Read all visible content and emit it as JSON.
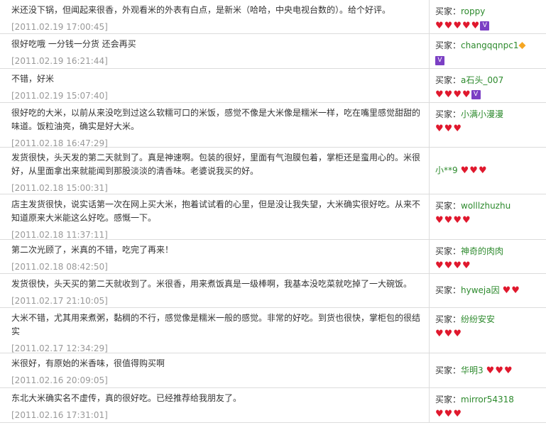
{
  "reviews": [
    {
      "comment": "米还没下锅，但闻起来很香，外观看米的外表有白点，是新米（哈哈，中央电视台数的）。给个好评。",
      "date": "[2011.02.19 17:00:45]",
      "buyer_label": "买家：",
      "buyer": "roppy",
      "hearts": 5,
      "badge": "vip",
      "height": 48
    },
    {
      "comment": "很好吃哦  一分钱一分货  还会再买",
      "date": "[2011.02.19 16:21:44]",
      "buyer_label": "买家：",
      "buyer": "changqqnpc1",
      "hearts": 0,
      "badge": "diamond+vip",
      "height": 49
    },
    {
      "comment": "不错，好米",
      "date": "[2011.02.19 15:07:40]",
      "buyer_label": "买家：",
      "buyer": "a石头_007",
      "hearts": 4,
      "badge": "vip",
      "height": 48
    },
    {
      "comment": "很好吃的大米，以前从来没吃到过这么软糯可口的米饭，感觉不像是大米像是糯米一样，吃在嘴里感觉甜甜的味道。饭粒油亮，确实是好大米。",
      "date": "[2011.02.18 16:47:29]",
      "buyer_label": "买家：",
      "buyer": "小满小漫漫",
      "hearts": 3,
      "badge": "",
      "height": 63
    },
    {
      "comment": "发货很快，头天发的第二天就到了。真是神速啊。包装的很好，里面有气泡膜包着，掌柜还是蛮用心的。米很好，从里面拿出来就能闻到那股淡淡的清香味。老婆说我买的好。",
      "date": "[2011.02.18 15:00:31]",
      "buyer_label": "",
      "buyer": "小**9",
      "hearts": 3,
      "badge": "",
      "inline": true,
      "height": 66
    },
    {
      "comment": "店主发货很快，说实话第一次在网上买大米，抱着试试看的心里，但是没让我失望，大米确实很好吃。从来不知道原来大米能这么好吃。感慨一下。",
      "date": "[2011.02.18 11:37:11]",
      "buyer_label": "买家：",
      "buyer": "wolllzhuzhu",
      "hearts": 4,
      "badge": "",
      "height": 64
    },
    {
      "comment": "第二次光顾了，米真的不错，吃完了再来！",
      "date": "[2011.02.18 08:42:50]",
      "buyer_label": "买家：",
      "buyer": "神奇的肉肉",
      "hearts": 4,
      "badge": "",
      "height": 48
    },
    {
      "comment": "发货很快，头天买的第二天就收到了。米很香，用来煮饭真是一级棒啊，我基本没吃菜就吃掉了一大碗饭。",
      "date": "[2011.02.17 21:10:05]",
      "buyer_label": "买家：",
      "buyer": "hyweja因",
      "hearts": 2,
      "badge": "",
      "inline": true,
      "height": 48
    },
    {
      "comment": "大米不错，尤其用来煮粥，黏稠的不行，感觉像是糯米一般的感觉。非常的好吃。到货也很快，掌柜包的很结实",
      "date": "[2011.02.17 12:34:29]",
      "buyer_label": "买家：",
      "buyer": "纷纷安安",
      "hearts": 3,
      "badge": "",
      "height": 64
    },
    {
      "comment": "米很好，有原始的米香味，很值得购买啊",
      "date": "[2011.02.16 20:09:05]",
      "buyer_label": "买家：",
      "buyer": "华明3",
      "hearts": 3,
      "badge": "",
      "inline": true,
      "height": 49
    },
    {
      "comment": "东北大米确实名不虚传，真的很好吃。已经推荐给我朋友了。",
      "date": "[2011.02.16 17:31:01]",
      "buyer_label": "买家：",
      "buyer": "mirror54318",
      "hearts": 3,
      "badge": "",
      "height": 49
    }
  ]
}
